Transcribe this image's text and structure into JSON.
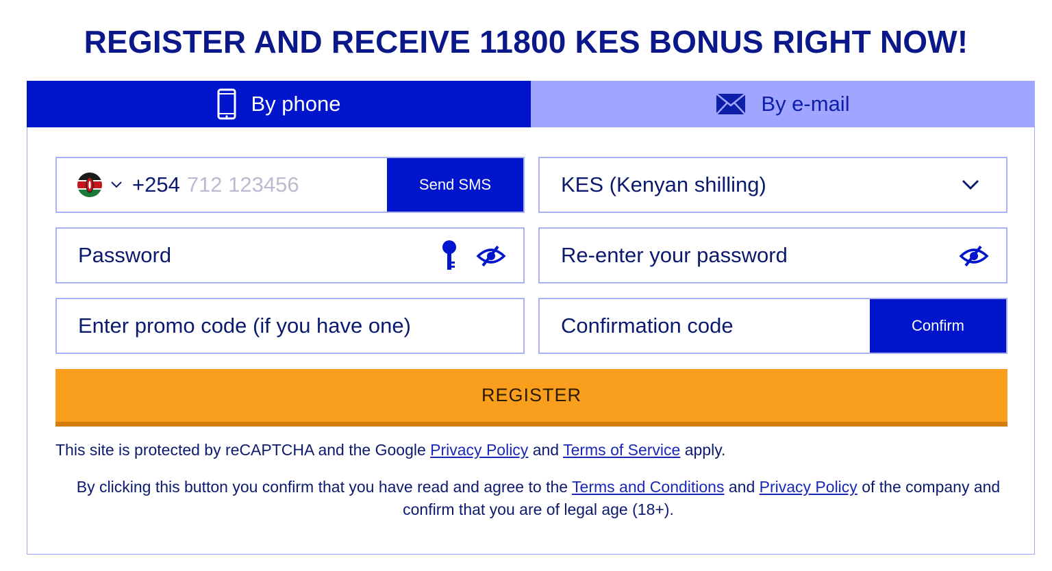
{
  "headline": "REGISTER AND RECEIVE 11800 KES BONUS RIGHT NOW!",
  "tabs": [
    {
      "label": "By phone",
      "icon": "phone-icon",
      "active": true
    },
    {
      "label": "By e-mail",
      "icon": "envelope-icon",
      "active": false
    }
  ],
  "phone": {
    "country_flag": "kenya-flag-icon",
    "code": "+254",
    "placeholder": "712 123456",
    "send_sms_label": "Send SMS"
  },
  "currency": {
    "selected": "KES (Kenyan shilling)"
  },
  "password": {
    "placeholder": "Password"
  },
  "repassword": {
    "placeholder": "Re-enter your password"
  },
  "promo": {
    "placeholder": "Enter promo code (if you have one)"
  },
  "confirmation": {
    "placeholder": "Confirmation code",
    "confirm_label": "Confirm"
  },
  "register_label": "REGISTER",
  "recaptcha": {
    "prefix": "This site is protected by reCAPTCHA and the Google",
    "privacy_link": "Privacy Policy",
    "and": "and",
    "terms_link": "Terms of Service",
    "suffix": "apply."
  },
  "legal": {
    "prefix": "By clicking this button you confirm that you have read and agree to the",
    "terms_link": "Terms and Conditions",
    "and": "and",
    "privacy_link": "Privacy Policy",
    "suffix": "of the company and confirm that you are of legal age (18+)."
  },
  "colors": {
    "brand_blue": "#0015cc",
    "tab_inactive": "#a0a6ff",
    "register_orange": "#fa9f1d",
    "heading_navy": "#0a1889"
  }
}
